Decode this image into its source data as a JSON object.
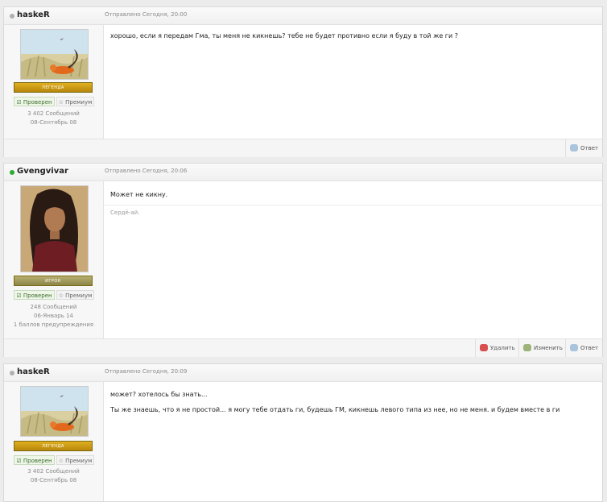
{
  "posts": [
    {
      "author": "haskeR",
      "online": false,
      "posted": "Отправлено Сегодня, 20:00",
      "avatar": "fox-on-grass-avatar",
      "rank": "ЛЕГЕНДА",
      "verified": "Проверен",
      "premium": "Премиум",
      "meta": [
        "3 402 Сообщений",
        "08-Сентябрь 08"
      ],
      "content": [
        "хорошо, если я передам Гма, ты меня не кикнешь? тебе не будет противно если я буду в той же ги ?"
      ],
      "signature": "",
      "actions": [
        "Ответ"
      ]
    },
    {
      "author": "Gvengvivar",
      "online": true,
      "posted": "Отправлено Сегодня, 20:06",
      "avatar": "dark-haired-woman-avatar",
      "rank": "ИГРОК",
      "verified": "Проверен",
      "premium": "Премиум",
      "meta": [
        "248 Сообщений",
        "06-Январь 14",
        "1 баллов предупреждения"
      ],
      "content": [
        "Может не кикну."
      ],
      "signature": "Сердё-ай.",
      "actions": [
        "Удалить",
        "Изменить",
        "Ответ"
      ]
    },
    {
      "author": "haskeR",
      "online": false,
      "posted": "Отправлено Сегодня, 20:09",
      "avatar": "fox-on-grass-avatar",
      "rank": "ЛЕГЕНДА",
      "verified": "Проверен",
      "premium": "Премиум",
      "meta": [
        "3 402 Сообщений",
        "08-Сентябрь 08"
      ],
      "content": [
        "может? хотелось бы  знать...",
        "Ты же знаешь, что я не простой... я могу тебе отдать ги, будешь ГМ, кикнешь левого типа из нее, но не меня. и будем вместе в ги"
      ],
      "signature": "",
      "actions": []
    }
  ],
  "colors": {
    "online": "#2eaa2e",
    "offline": "#b0b0b0",
    "rank_gold": "#c9a020",
    "rank_olive": "#9c9660"
  }
}
